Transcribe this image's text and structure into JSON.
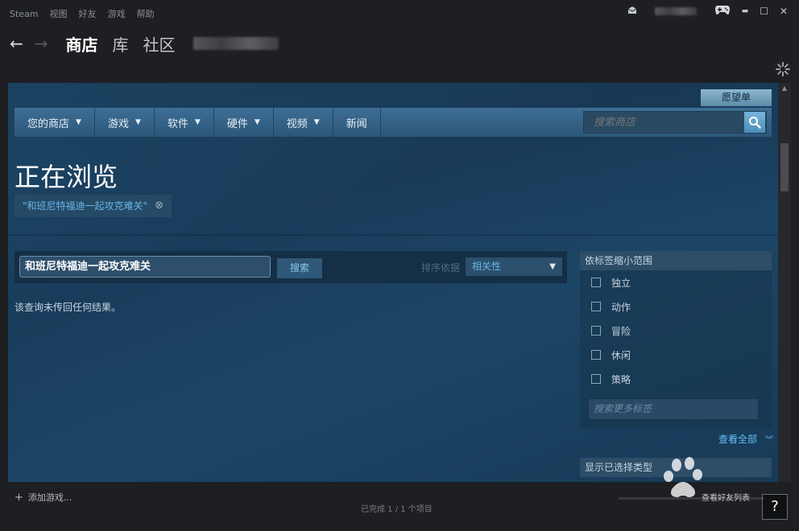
{
  "menubar": {
    "items": [
      "Steam",
      "视图",
      "好友",
      "游戏",
      "帮助"
    ]
  },
  "window": {
    "icons": [
      "mail-icon",
      "controller-icon",
      "minimize-icon",
      "maximize-icon",
      "close-icon"
    ],
    "minimize": "▬",
    "maximize": "☐",
    "close": "✕"
  },
  "nav": {
    "back": "←",
    "forward": "→",
    "links": [
      "商店",
      "库",
      "社区"
    ],
    "active": "商店"
  },
  "store": {
    "wishlist": "愿望单",
    "tabs": [
      {
        "label": "您的商店",
        "has_caret": true
      },
      {
        "label": "游戏",
        "has_caret": true
      },
      {
        "label": "软件",
        "has_caret": true
      },
      {
        "label": "硬件",
        "has_caret": true
      },
      {
        "label": "视频",
        "has_caret": true
      },
      {
        "label": "新闻",
        "has_caret": false
      }
    ],
    "search_placeholder": "搜索商店",
    "heading": "正在浏览",
    "filter_chip": "\"和班尼特福迪一起攻克难关\"",
    "search_term": "和班尼特福迪一起攻克难关",
    "search_button": "搜索",
    "sort_label": "排序依据",
    "sort_value": "相关性",
    "no_results": "该查询未传回任何结果。",
    "tag_panel": {
      "title": "依标签缩小范围",
      "tags": [
        "独立",
        "动作",
        "冒险",
        "休闲",
        "策略"
      ],
      "more_placeholder": "搜索更多标签",
      "see_all": "查看全部"
    },
    "type_panel_title": "显示已选择类型"
  },
  "bottom": {
    "add_game": "添加游戏...",
    "progress": "已完成 1 / 1 个项目",
    "friends": "查看好友列表",
    "help": "?"
  },
  "colors": {
    "accent": "#67c1f5",
    "store_bg": "#1b3f5e",
    "nav_bar": "#3e6e96"
  }
}
